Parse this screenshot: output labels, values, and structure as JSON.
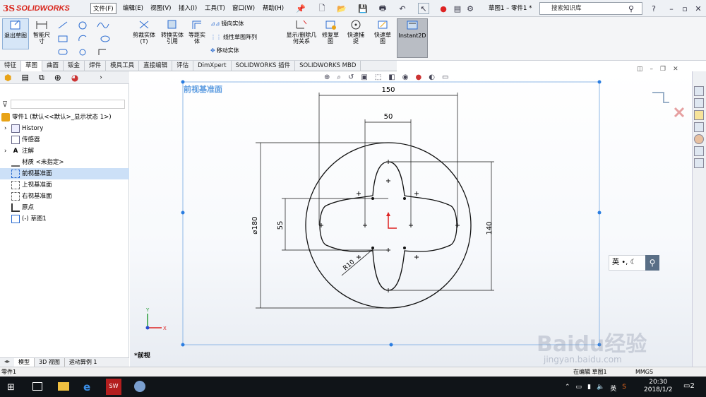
{
  "app": {
    "logo_ds": "3S",
    "logo_name": "SOLIDWORKS",
    "doc_title": "草图1 – 零件1 *",
    "search_placeholder": "搜索知识库"
  },
  "menu": [
    "文件(F)",
    "编辑(E)",
    "视图(V)",
    "插入(I)",
    "工具(T)",
    "窗口(W)",
    "帮助(H)"
  ],
  "ribbon": {
    "exit_sketch": "退出草图",
    "smart_dim": "智能尺寸",
    "trim": "剪裁实体(T)",
    "convert": "转换实体引用",
    "offset": "等距实体",
    "mirror": "镜向实体",
    "linear_pattern": "线性草图阵列",
    "move": "移动实体",
    "show_relations": "显示/删除几何关系",
    "repair": "修复草图",
    "quick_snap": "快速捕捉",
    "quick_sketch": "快速草图",
    "instant2d": "Instant2D"
  },
  "tabs": [
    "特征",
    "草图",
    "曲面",
    "钣金",
    "焊件",
    "模具工具",
    "直接编辑",
    "评估",
    "DimXpert",
    "SOLIDWORKS 插件",
    "SOLIDWORKS MBD"
  ],
  "active_tab": "草图",
  "tree": {
    "root": "零件1 (默认<<默认>_显示状态 1>)",
    "items": [
      "History",
      "传感器",
      "注解",
      "材质 <未指定>",
      "前视基准面",
      "上视基准面",
      "右视基准面",
      "原点",
      "(-) 草图1"
    ]
  },
  "viewport": {
    "plane_label": "前视基准面",
    "view_label": "*前视"
  },
  "dimensions": {
    "d150": "150",
    "d50": "50",
    "dia180": "⌀180",
    "d55": "55",
    "d140": "140",
    "r10": "R10"
  },
  "bottom_tabs": [
    "模型",
    "3D 视图",
    "运动算例 1"
  ],
  "status": {
    "left": "零件1",
    "editing": "在编辑 草图1",
    "units": "MMGS"
  },
  "ime": {
    "label": "英"
  },
  "clock": {
    "time": "20:30",
    "date": "2018/1/2"
  },
  "taskbar": {
    "ime": "英",
    "notif": "2"
  },
  "watermark": {
    "main": "Baidu经验",
    "sub": "jingyan.baidu.com"
  },
  "colors": {
    "accent": "#1a6fd0",
    "sketch_blue": "#2a7de1",
    "logo_red": "#d9261c"
  }
}
